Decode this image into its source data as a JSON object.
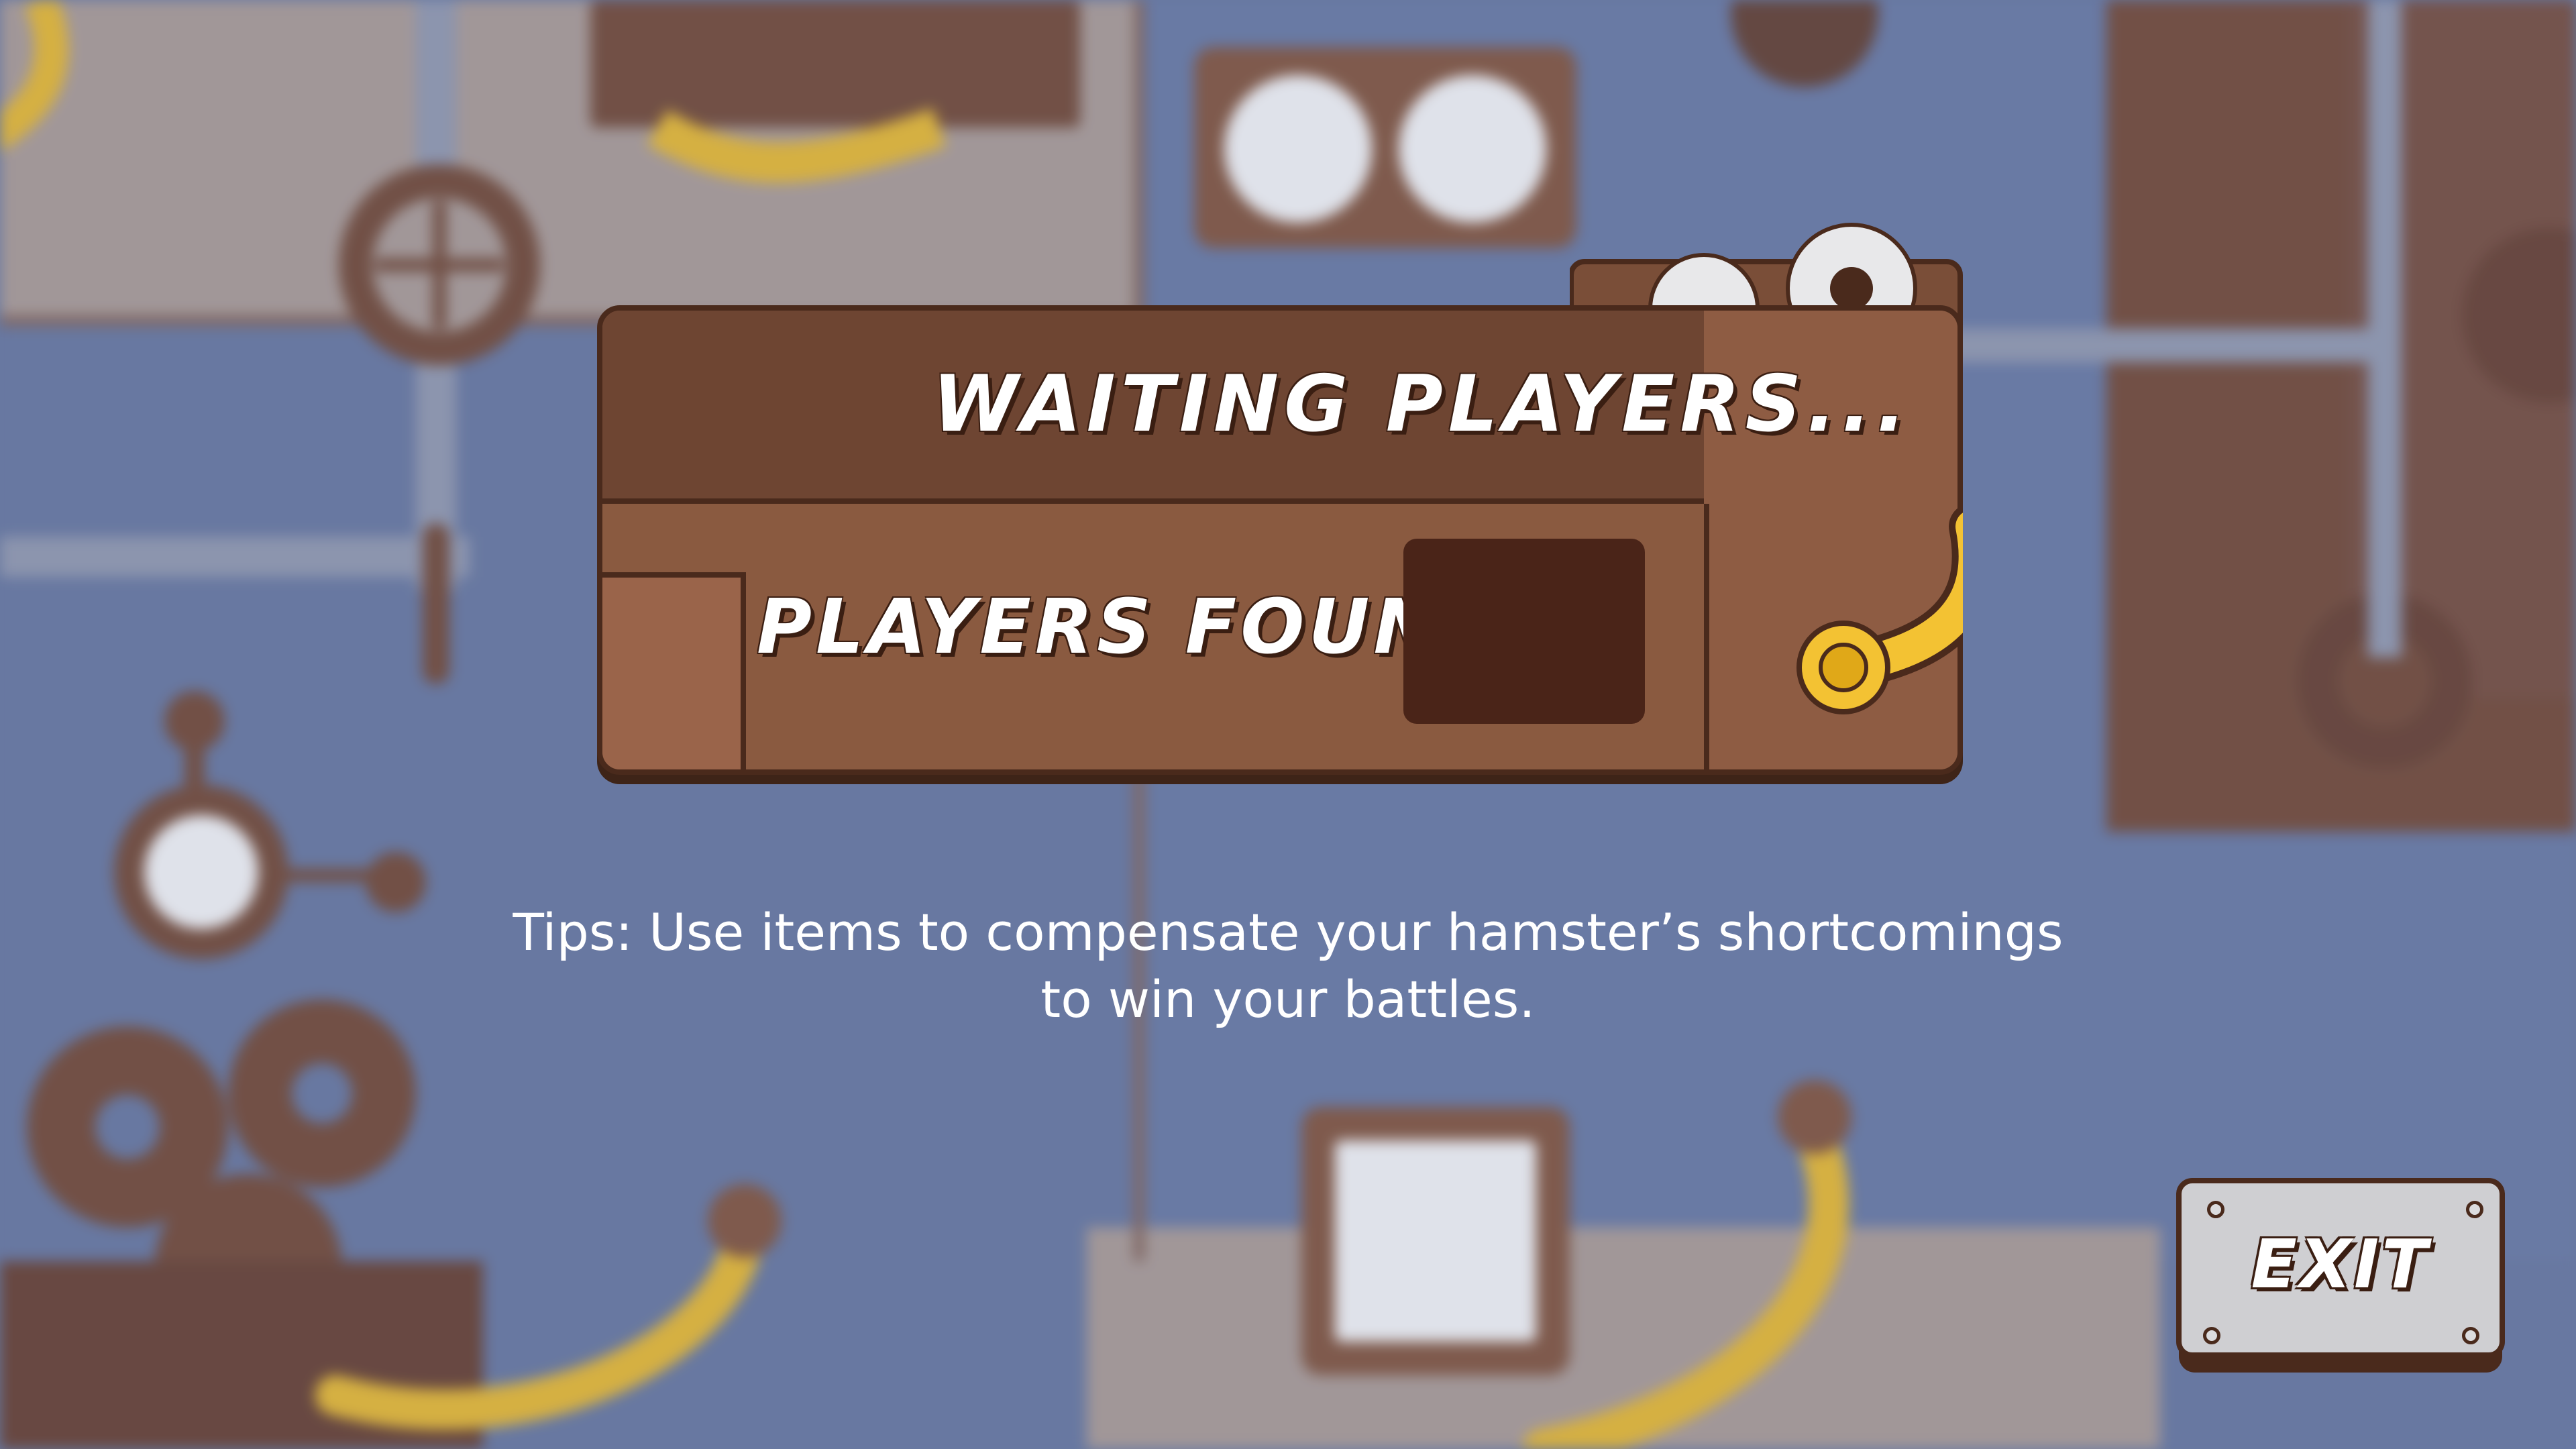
{
  "screen": {
    "title": "WAITING PLAYERS...",
    "players_found_label": "PLAYERS FOUND:",
    "players_found_value": ""
  },
  "tips": {
    "line1": "Tips: Use items to compensate your hamster’s shortcomings",
    "line2": "to win your battles."
  },
  "exit_button": {
    "label": "EXIT"
  },
  "colors": {
    "wall_blue": "#6e7ea6",
    "wall_beige": "#b4a49c",
    "panel_brown": "#8a5a40",
    "panel_dark": "#6e4532",
    "outline": "#4a2a1c",
    "cable_yellow": "#f3c233",
    "button_grey": "#cfcfd2"
  },
  "icons": [
    "gear-icon",
    "valve-wheel-icon",
    "pressure-gauge-icon",
    "cable-plug-icon"
  ]
}
